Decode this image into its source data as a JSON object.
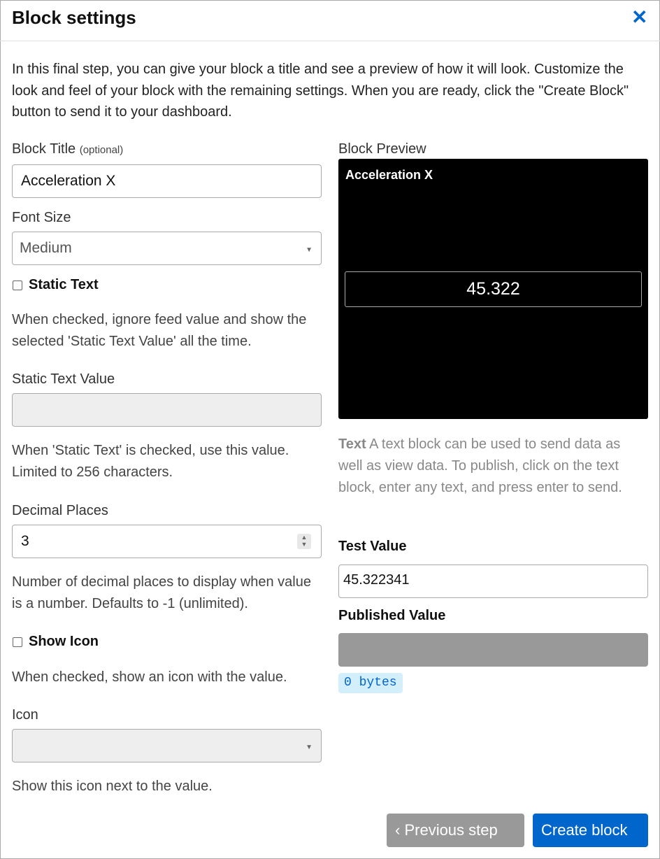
{
  "dialog": {
    "title": "Block settings",
    "close_icon": "close-icon"
  },
  "intro": "In this final step, you can give your block a title and see a preview of how it will look. Customize the look and feel of your block with the remaining settings. When you are ready, click the \"Create Block\" button to send it to your dashboard.",
  "form": {
    "block_title_label": "Block Title",
    "block_title_optional": "(optional)",
    "block_title_value": "Acceleration X",
    "font_size_label": "Font Size",
    "font_size_value": "Medium",
    "static_text_label": "Static Text",
    "static_text_checked": false,
    "static_text_help": "When checked, ignore feed value and show the selected 'Static Text Value' all the time.",
    "static_text_value_label": "Static Text Value",
    "static_text_value": "",
    "static_text_value_help": "When 'Static Text' is checked, use this value. Limited to 256 characters.",
    "decimal_places_label": "Decimal Places",
    "decimal_places_value": "3",
    "decimal_places_help": "Number of decimal places to display when value is a number. Defaults to -1 (unlimited).",
    "show_icon_label": "Show Icon",
    "show_icon_checked": false,
    "show_icon_help": "When checked, show an icon with the value.",
    "icon_label": "Icon",
    "icon_value": "",
    "icon_help": "Show this icon next to the value."
  },
  "preview": {
    "label": "Block Preview",
    "block_title": "Acceleration X",
    "block_value": "45.322",
    "desc_strong": "Text",
    "desc": " A text block can be used to send data as well as view data. To publish, click on the text block, enter any text, and press enter to send.",
    "test_value_label": "Test Value",
    "test_value": "45.322341",
    "published_value_label": "Published Value",
    "published_value": "",
    "bytes": "0 bytes"
  },
  "footer": {
    "previous": "Previous step",
    "create": "Create block"
  },
  "colors": {
    "accent": "#0066cc",
    "disabled_button": "#999999",
    "badge_bg": "#d4effc"
  }
}
